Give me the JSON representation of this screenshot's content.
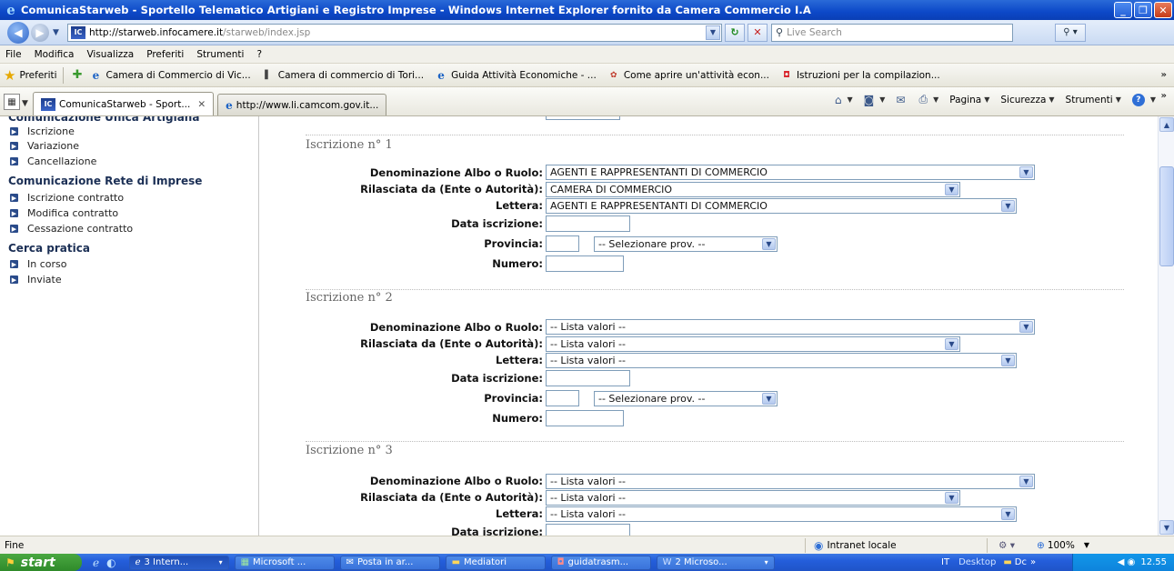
{
  "window": {
    "title": "ComunicaStarweb - Sportello Telematico Artigiani e Registro Imprese - Windows Internet Explorer fornito da Camera Commercio I.A",
    "buttons": {
      "minimize": "_",
      "maximize": "❐",
      "close": "✕"
    }
  },
  "address": {
    "url_host": "http://starweb.infocamere.it",
    "url_path": "/starweb/index.jsp",
    "search_placeholder": "Live Search"
  },
  "menu": [
    "File",
    "Modifica",
    "Visualizza",
    "Preferiti",
    "Strumenti",
    "?"
  ],
  "favorites": {
    "label": "Preferiti",
    "items": [
      "Camera di Commercio di Vic...",
      "Camera di commercio di Tori...",
      "Guida Attività Economiche - ...",
      "Come aprire un'attività econ...",
      "Istruzioni per la compilazion..."
    ]
  },
  "tabs": [
    {
      "label": "ComunicaStarweb - Sport...",
      "active": true
    },
    {
      "label": "http://www.li.camcom.gov.it...",
      "active": false
    }
  ],
  "commands": {
    "page": "Pagina",
    "security": "Sicurezza",
    "tools": "Strumenti"
  },
  "sidebar": {
    "cut_heading": "Comunicazione Unica Artigiana",
    "group1": [
      "Iscrizione",
      "Variazione",
      "Cancellazione"
    ],
    "heading2": "Comunicazione Rete di Imprese",
    "group2": [
      "Iscrizione contratto",
      "Modifica contratto",
      "Cessazione contratto"
    ],
    "heading3": "Cerca pratica",
    "group3": [
      "In corso",
      "Inviate"
    ]
  },
  "labels": {
    "albo": "Denominazione Albo o Ruolo:",
    "ente": "Rilasciata da (Ente o Autorità):",
    "lettera": "Lettera:",
    "data": "Data iscrizione:",
    "provincia": "Provincia:",
    "numero": "Numero:"
  },
  "sections": [
    {
      "title": "Iscrizione n° 1",
      "albo": "AGENTI E RAPPRESENTANTI DI COMMERCIO",
      "ente": "CAMERA DI COMMERCIO",
      "lettera": "AGENTI E RAPPRESENTANTI DI COMMERCIO",
      "prov_select": "-- Selezionare prov. --"
    },
    {
      "title": "Iscrizione n° 2",
      "albo": "-- Lista valori --",
      "ente": "-- Lista valori --",
      "lettera": "-- Lista valori --",
      "prov_select": "-- Selezionare prov. --"
    },
    {
      "title": "Iscrizione n° 3",
      "albo": "-- Lista valori --",
      "ente": "-- Lista valori --",
      "lettera": "-- Lista valori --"
    }
  ],
  "status": {
    "text": "Fine",
    "zone": "Intranet locale",
    "zoom": "100%"
  },
  "taskbar": {
    "start": "start",
    "tasks": [
      "3 Intern...",
      "Microsoft ...",
      "Posta in ar...",
      "Mediatori",
      "guidatrasm...",
      "2 Microso..."
    ],
    "lang": "IT",
    "desktop": "Desktop",
    "dc": "Dc",
    "clock": "12.55"
  }
}
